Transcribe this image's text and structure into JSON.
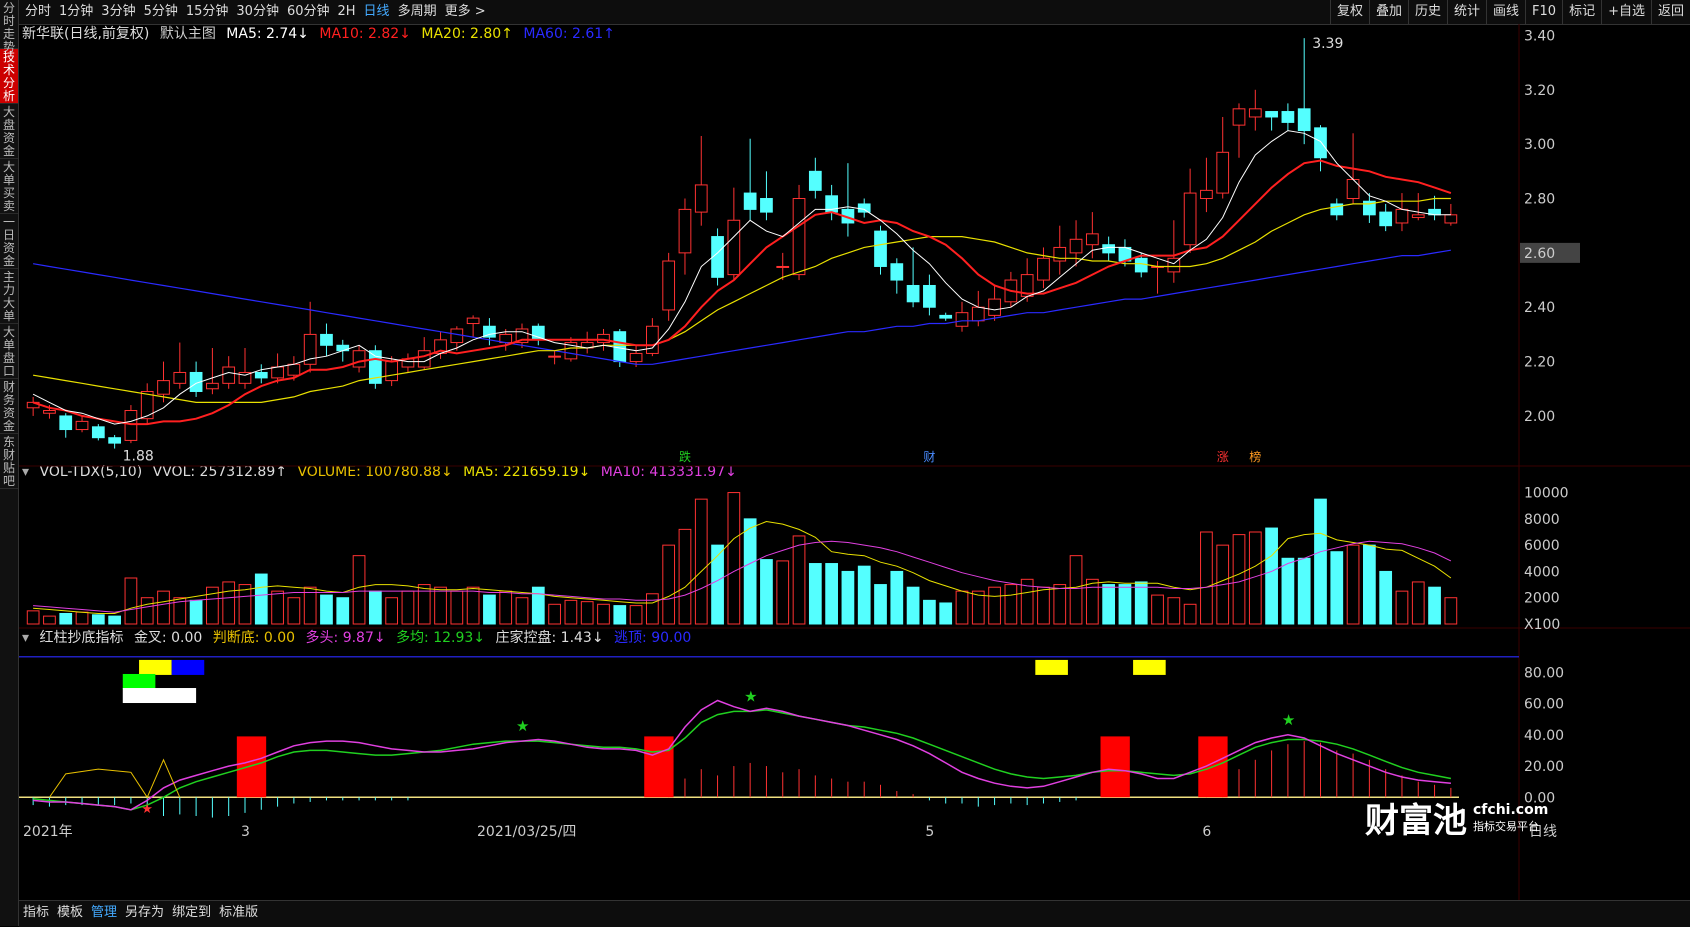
{
  "left_tabs": [
    "分时走势",
    "技术分析",
    "大盘资金",
    "大单买卖",
    "一日资金",
    "主力大单",
    "大单盘口",
    "财务资金",
    "东财贴吧"
  ],
  "active_left_tab": 1,
  "topbar": {
    "periods": [
      "分时",
      "1分钟",
      "3分钟",
      "5分钟",
      "15分钟",
      "30分钟",
      "60分钟",
      "2H",
      "日线",
      "多周期",
      "更多 >"
    ],
    "active_period": "日线",
    "right_buttons": [
      "复权",
      "叠加",
      "历史",
      "统计",
      "画线",
      "F10",
      "标记",
      "+自选",
      "返回"
    ]
  },
  "main_legend": {
    "stock": "新华联(日线,前复权)",
    "template": "默认主图",
    "ma5": "MA5: 2.74↓",
    "ma10": "MA10: 2.82↓",
    "ma20": "MA20: 2.80↑",
    "ma60": "MA60: 2.61↑"
  },
  "vol_legend": {
    "name": "VOL-TDX(5,10)",
    "vvol": "VVOL: 257312.89↑",
    "volume": "VOLUME: 100780.88↓",
    "ma5": "MA5: 221659.19↓",
    "ma10": "MA10: 413331.97↓"
  },
  "ind_legend": {
    "name": "红柱抄底指标",
    "jincha": "金叉: 0.00",
    "pandidi": "判断底: 0.00",
    "duotou": "多头: 9.87↓",
    "duojun": "多均: 12.93↓",
    "zhuangjia": "庄家控盘: 1.43↓",
    "taoding": "逃顶: 90.00"
  },
  "price_axis": [
    "3.40",
    "3.20",
    "3.00",
    "2.80",
    "2.60",
    "2.40",
    "2.20",
    "2.00"
  ],
  "current_price": "2.60",
  "vol_axis": [
    "10000",
    "8000",
    "6000",
    "4000",
    "2000",
    "X100"
  ],
  "ind_axis": [
    "80.00",
    "60.00",
    "40.00",
    "20.00",
    "0.00"
  ],
  "annotations": {
    "high": "3.39",
    "low": "1.88"
  },
  "event_markers": [
    "跌",
    "财",
    "涨",
    "榜"
  ],
  "time_axis": [
    "2021年",
    "3",
    "2021/03/25/四",
    "5",
    "6"
  ],
  "period_corner": "日线",
  "bottombar": {
    "items": [
      "指标",
      "模板",
      "管理",
      "另存为",
      "绑定到",
      "标准版"
    ],
    "active": "管理"
  },
  "watermark": {
    "brand": "财富池",
    "site": "cfchi.com",
    "tagline": "指标交易平台"
  },
  "colors": {
    "up": "#ff3232",
    "down": "#54ffff",
    "ma5": "#ffffff",
    "ma10": "#ff2020",
    "ma20": "#e8e000",
    "ma60": "#2a2aff",
    "magenta": "#e040e0",
    "green": "#20d020"
  },
  "chart_data": {
    "type": "candlestick",
    "price_range": [
      1.86,
      3.42
    ],
    "candles": [
      [
        2.03,
        2.05,
        2.0,
        2.07
      ],
      [
        2.01,
        2.02,
        1.99,
        2.04
      ],
      [
        2.0,
        1.95,
        1.92,
        2.01
      ],
      [
        1.95,
        1.98,
        1.94,
        2.0
      ],
      [
        1.96,
        1.92,
        1.91,
        1.97
      ],
      [
        1.92,
        1.9,
        1.88,
        1.93
      ],
      [
        1.91,
        2.02,
        1.9,
        2.04
      ],
      [
        1.99,
        2.09,
        1.97,
        2.12
      ],
      [
        2.08,
        2.13,
        2.05,
        2.2
      ],
      [
        2.12,
        2.16,
        2.1,
        2.27
      ],
      [
        2.16,
        2.09,
        2.07,
        2.2
      ],
      [
        2.1,
        2.12,
        2.08,
        2.25
      ],
      [
        2.12,
        2.18,
        2.1,
        2.22
      ],
      [
        2.12,
        2.16,
        2.1,
        2.25
      ],
      [
        2.16,
        2.14,
        2.12,
        2.19
      ],
      [
        2.14,
        2.18,
        2.12,
        2.23
      ],
      [
        2.15,
        2.19,
        2.13,
        2.22
      ],
      [
        2.19,
        2.3,
        2.16,
        2.42
      ],
      [
        2.3,
        2.26,
        2.22,
        2.34
      ],
      [
        2.26,
        2.24,
        2.2,
        2.28
      ],
      [
        2.18,
        2.24,
        2.16,
        2.26
      ],
      [
        2.24,
        2.12,
        2.1,
        2.26
      ],
      [
        2.13,
        2.2,
        2.11,
        2.22
      ],
      [
        2.18,
        2.21,
        2.16,
        2.23
      ],
      [
        2.18,
        2.24,
        2.17,
        2.29
      ],
      [
        2.23,
        2.28,
        2.21,
        2.31
      ],
      [
        2.27,
        2.32,
        2.24,
        2.33
      ],
      [
        2.34,
        2.36,
        2.29,
        2.37
      ],
      [
        2.33,
        2.29,
        2.26,
        2.36
      ],
      [
        2.27,
        2.3,
        2.24,
        2.32
      ],
      [
        2.27,
        2.32,
        2.25,
        2.34
      ],
      [
        2.33,
        2.28,
        2.26,
        2.34
      ],
      [
        2.22,
        2.22,
        2.19,
        2.24
      ],
      [
        2.21,
        2.27,
        2.2,
        2.29
      ],
      [
        2.25,
        2.27,
        2.23,
        2.31
      ],
      [
        2.27,
        2.3,
        2.24,
        2.32
      ],
      [
        2.31,
        2.2,
        2.18,
        2.32
      ],
      [
        2.2,
        2.23,
        2.18,
        2.26
      ],
      [
        2.23,
        2.33,
        2.22,
        2.36
      ],
      [
        2.39,
        2.57,
        2.35,
        2.6
      ],
      [
        2.6,
        2.76,
        2.52,
        2.8
      ],
      [
        2.75,
        2.85,
        2.7,
        3.03
      ],
      [
        2.66,
        2.51,
        2.48,
        2.69
      ],
      [
        2.52,
        2.72,
        2.5,
        2.84
      ],
      [
        2.82,
        2.76,
        2.72,
        3.02
      ],
      [
        2.8,
        2.75,
        2.72,
        2.9
      ],
      [
        2.55,
        2.55,
        2.5,
        2.6
      ],
      [
        2.52,
        2.8,
        2.5,
        2.85
      ],
      [
        2.9,
        2.83,
        2.8,
        2.95
      ],
      [
        2.81,
        2.75,
        2.72,
        2.85
      ],
      [
        2.76,
        2.71,
        2.66,
        2.93
      ],
      [
        2.78,
        2.75,
        2.73,
        2.8
      ],
      [
        2.68,
        2.55,
        2.52,
        2.7
      ],
      [
        2.56,
        2.5,
        2.45,
        2.58
      ],
      [
        2.48,
        2.42,
        2.4,
        2.62
      ],
      [
        2.48,
        2.4,
        2.37,
        2.52
      ],
      [
        2.37,
        2.36,
        2.35,
        2.38
      ],
      [
        2.33,
        2.38,
        2.31,
        2.42
      ],
      [
        2.35,
        2.4,
        2.33,
        2.46
      ],
      [
        2.37,
        2.43,
        2.35,
        2.48
      ],
      [
        2.42,
        2.5,
        2.4,
        2.53
      ],
      [
        2.44,
        2.52,
        2.42,
        2.58
      ],
      [
        2.5,
        2.58,
        2.47,
        2.62
      ],
      [
        2.57,
        2.62,
        2.52,
        2.7
      ],
      [
        2.6,
        2.65,
        2.55,
        2.72
      ],
      [
        2.63,
        2.67,
        2.58,
        2.75
      ],
      [
        2.63,
        2.6,
        2.57,
        2.66
      ],
      [
        2.62,
        2.57,
        2.55,
        2.65
      ],
      [
        2.58,
        2.53,
        2.51,
        2.6
      ],
      [
        2.55,
        2.55,
        2.45,
        2.57
      ],
      [
        2.53,
        2.58,
        2.49,
        2.72
      ],
      [
        2.63,
        2.82,
        2.6,
        2.91
      ],
      [
        2.8,
        2.83,
        2.75,
        2.95
      ],
      [
        2.82,
        2.97,
        2.8,
        3.1
      ],
      [
        3.07,
        3.13,
        2.95,
        3.15
      ],
      [
        3.1,
        3.13,
        3.05,
        3.2
      ],
      [
        3.12,
        3.1,
        3.05,
        3.12
      ],
      [
        3.12,
        3.08,
        3.05,
        3.15
      ],
      [
        3.13,
        3.05,
        3.0,
        3.39
      ],
      [
        3.06,
        2.95,
        2.9,
        3.07
      ],
      [
        2.78,
        2.74,
        2.72,
        2.8
      ],
      [
        2.8,
        2.87,
        2.78,
        3.04
      ],
      [
        2.79,
        2.74,
        2.71,
        2.82
      ],
      [
        2.75,
        2.7,
        2.68,
        2.78
      ],
      [
        2.71,
        2.76,
        2.68,
        2.82
      ],
      [
        2.73,
        2.74,
        2.72,
        2.82
      ],
      [
        2.76,
        2.74,
        2.72,
        2.81
      ],
      [
        2.71,
        2.74,
        2.7,
        2.78
      ]
    ],
    "ma5": [
      2.08,
      2.05,
      2.02,
      2.01,
      1.99,
      1.97,
      1.98,
      2.0,
      2.03,
      2.08,
      2.12,
      2.14,
      2.16,
      2.15,
      2.17,
      2.18,
      2.19,
      2.21,
      2.22,
      2.24,
      2.26,
      2.22,
      2.21,
      2.2,
      2.2,
      2.23,
      2.25,
      2.28,
      2.3,
      2.31,
      2.31,
      2.29,
      2.27,
      2.26,
      2.25,
      2.26,
      2.25,
      2.24,
      2.25,
      2.32,
      2.42,
      2.55,
      2.6,
      2.66,
      2.72,
      2.68,
      2.66,
      2.71,
      2.76,
      2.76,
      2.77,
      2.76,
      2.72,
      2.67,
      2.61,
      2.56,
      2.49,
      2.43,
      2.4,
      2.39,
      2.4,
      2.44,
      2.46,
      2.51,
      2.56,
      2.61,
      2.62,
      2.62,
      2.6,
      2.58,
      2.56,
      2.61,
      2.65,
      2.73,
      2.86,
      2.96,
      3.01,
      3.05,
      3.04,
      3.01,
      2.93,
      2.87,
      2.81,
      2.79,
      2.76,
      2.75,
      2.74,
      2.74
    ],
    "ma10": [
      2.05,
      2.03,
      2.02,
      2.0,
      1.99,
      1.98,
      1.97,
      1.97,
      1.98,
      1.98,
      1.99,
      2.01,
      2.04,
      2.08,
      2.11,
      2.13,
      2.14,
      2.17,
      2.17,
      2.18,
      2.2,
      2.21,
      2.2,
      2.21,
      2.22,
      2.24,
      2.23,
      2.24,
      2.25,
      2.26,
      2.28,
      2.28,
      2.28,
      2.28,
      2.28,
      2.28,
      2.27,
      2.26,
      2.26,
      2.28,
      2.33,
      2.4,
      2.46,
      2.5,
      2.56,
      2.62,
      2.66,
      2.7,
      2.74,
      2.75,
      2.73,
      2.71,
      2.72,
      2.71,
      2.68,
      2.66,
      2.63,
      2.58,
      2.52,
      2.48,
      2.46,
      2.45,
      2.45,
      2.47,
      2.49,
      2.52,
      2.55,
      2.57,
      2.59,
      2.59,
      2.59,
      2.61,
      2.62,
      2.66,
      2.72,
      2.78,
      2.84,
      2.89,
      2.93,
      2.94,
      2.92,
      2.91,
      2.9,
      2.88,
      2.87,
      2.86,
      2.84,
      2.82
    ],
    "ma20": [
      2.15,
      2.14,
      2.13,
      2.12,
      2.11,
      2.1,
      2.09,
      2.08,
      2.07,
      2.06,
      2.05,
      2.05,
      2.05,
      2.05,
      2.05,
      2.06,
      2.07,
      2.09,
      2.1,
      2.11,
      2.13,
      2.14,
      2.15,
      2.16,
      2.17,
      2.18,
      2.19,
      2.2,
      2.21,
      2.22,
      2.23,
      2.24,
      2.24,
      2.25,
      2.25,
      2.26,
      2.26,
      2.26,
      2.26,
      2.28,
      2.31,
      2.35,
      2.39,
      2.42,
      2.45,
      2.48,
      2.51,
      2.53,
      2.55,
      2.58,
      2.6,
      2.62,
      2.63,
      2.64,
      2.65,
      2.66,
      2.66,
      2.66,
      2.65,
      2.64,
      2.62,
      2.6,
      2.59,
      2.58,
      2.58,
      2.57,
      2.57,
      2.56,
      2.56,
      2.55,
      2.55,
      2.55,
      2.56,
      2.58,
      2.61,
      2.64,
      2.68,
      2.71,
      2.74,
      2.76,
      2.77,
      2.78,
      2.78,
      2.79,
      2.79,
      2.79,
      2.8,
      2.8
    ],
    "ma60": [
      2.56,
      2.55,
      2.54,
      2.53,
      2.52,
      2.51,
      2.5,
      2.49,
      2.48,
      2.47,
      2.46,
      2.45,
      2.44,
      2.43,
      2.42,
      2.41,
      2.4,
      2.39,
      2.38,
      2.37,
      2.36,
      2.35,
      2.34,
      2.33,
      2.32,
      2.31,
      2.3,
      2.29,
      2.28,
      2.27,
      2.26,
      2.25,
      2.24,
      2.23,
      2.22,
      2.21,
      2.2,
      2.19,
      2.19,
      2.2,
      2.21,
      2.22,
      2.23,
      2.24,
      2.25,
      2.26,
      2.27,
      2.28,
      2.29,
      2.3,
      2.31,
      2.31,
      2.32,
      2.33,
      2.33,
      2.34,
      2.34,
      2.35,
      2.35,
      2.36,
      2.37,
      2.38,
      2.38,
      2.39,
      2.4,
      2.41,
      2.42,
      2.43,
      2.43,
      2.44,
      2.45,
      2.46,
      2.47,
      2.48,
      2.49,
      2.5,
      2.51,
      2.52,
      2.53,
      2.54,
      2.55,
      2.56,
      2.57,
      2.58,
      2.59,
      2.59,
      2.6,
      2.61
    ],
    "volume": [
      1000,
      600,
      800,
      900,
      700,
      600,
      3500,
      2000,
      2500,
      2000,
      1800,
      2800,
      3200,
      3000,
      3800,
      2500,
      2000,
      2800,
      2200,
      2000,
      5200,
      2500,
      2000,
      2500,
      3000,
      2800,
      2500,
      2800,
      2200,
      2500,
      2000,
      2800,
      1500,
      1800,
      1700,
      1500,
      1400,
      1400,
      2300,
      6000,
      7200,
      9500,
      6000,
      10000,
      8000,
      4900,
      4800,
      6700,
      4600,
      4600,
      4000,
      4400,
      3000,
      4000,
      2800,
      1800,
      1600,
      2500,
      2500,
      2800,
      3000,
      3400,
      2800,
      3000,
      5200,
      3400,
      3000,
      3000,
      3200,
      2200,
      2000,
      1500,
      7000,
      6000,
      6800,
      7000,
      7300,
      5000,
      5000,
      9500,
      5500,
      6000,
      6000,
      4000,
      2500,
      3200,
      2800,
      2000
    ],
    "vol_ma5": [
      1200,
      1100,
      1000,
      900,
      800,
      800,
      1200,
      1500,
      1700,
      1900,
      2100,
      2300,
      2500,
      2600,
      2800,
      2900,
      2800,
      2700,
      2500,
      2400,
      2800,
      3000,
      3000,
      2900,
      2700,
      2600,
      2600,
      2700,
      2600,
      2500,
      2400,
      2300,
      2100,
      2000,
      1900,
      1800,
      1700,
      1600,
      1600,
      2100,
      2800,
      4000,
      5200,
      6500,
      7300,
      7800,
      7600,
      7200,
      6600,
      5500,
      5300,
      5200,
      4700,
      4400,
      3900,
      3300,
      2900,
      2500,
      2200,
      2100,
      2200,
      2400,
      2600,
      2700,
      2800,
      3100,
      3200,
      3100,
      3100,
      3100,
      2800,
      2600,
      2800,
      3300,
      3800,
      4400,
      5200,
      6500,
      6800,
      6900,
      6400,
      6200,
      6000,
      5700,
      5600,
      5000,
      4400,
      3500
    ],
    "vol_ma10": [
      1400,
      1300,
      1200,
      1100,
      1000,
      900,
      1100,
      1300,
      1500,
      1700,
      1800,
      1900,
      2000,
      2100,
      2200,
      2300,
      2400,
      2400,
      2400,
      2400,
      2500,
      2500,
      2500,
      2500,
      2500,
      2500,
      2500,
      2500,
      2400,
      2400,
      2300,
      2300,
      2200,
      2100,
      2000,
      1900,
      1900,
      1800,
      1800,
      1900,
      2200,
      2700,
      3300,
      4000,
      4600,
      5200,
      5600,
      6000,
      6200,
      6300,
      6200,
      6000,
      5800,
      5500,
      5100,
      4700,
      4300,
      3900,
      3600,
      3300,
      3100,
      2900,
      2800,
      2700,
      2700,
      2800,
      2800,
      2800,
      2800,
      2800,
      2700,
      2700,
      2800,
      3000,
      3200,
      3600,
      4000,
      4600,
      5000,
      5500,
      5800,
      6100,
      6300,
      6200,
      6100,
      5800,
      5400,
      4800
    ],
    "ind_magenta": [
      -2,
      -3,
      -3,
      -4,
      -5,
      -6,
      -8,
      -2,
      6,
      11,
      14,
      17,
      20,
      22,
      25,
      29,
      33,
      35,
      36,
      36,
      35,
      33,
      31,
      30,
      29,
      29,
      30,
      31,
      33,
      35,
      36,
      37,
      36,
      34,
      32,
      31,
      31,
      30,
      27,
      31,
      45,
      56,
      62,
      58,
      55,
      57,
      55,
      52,
      50,
      48,
      46,
      43,
      40,
      37,
      33,
      28,
      22,
      16,
      12,
      9,
      7,
      6,
      7,
      10,
      13,
      16,
      18,
      17,
      15,
      12,
      12,
      16,
      20,
      25,
      30,
      35,
      38,
      40,
      38,
      33,
      28,
      24,
      20,
      16,
      13,
      11,
      10,
      9
    ],
    "ind_green": [
      -1,
      -2,
      -3,
      -4,
      -5,
      -6,
      -8,
      -5,
      0,
      6,
      10,
      13,
      16,
      19,
      22,
      26,
      29,
      30,
      30,
      29,
      28,
      27,
      27,
      28,
      29,
      30,
      32,
      34,
      35,
      36,
      36,
      36,
      35,
      34,
      33,
      32,
      32,
      31,
      29,
      30,
      38,
      48,
      53,
      55,
      55,
      56,
      54,
      52,
      50,
      48,
      46,
      45,
      43,
      41,
      38,
      34,
      30,
      26,
      22,
      18,
      15,
      13,
      12,
      13,
      14,
      16,
      17,
      17,
      16,
      15,
      14,
      15,
      18,
      22,
      27,
      32,
      35,
      37,
      37,
      36,
      34,
      31,
      27,
      23,
      19,
      16,
      14,
      12
    ],
    "ind_bars": [
      -5,
      -6,
      -5,
      -5,
      -5,
      -5,
      -4,
      -8,
      -12,
      -11,
      -12,
      -13,
      -12,
      -10,
      -8,
      -6,
      -4,
      -3,
      -2,
      -2,
      -2,
      -2,
      -2,
      -2,
      0,
      0,
      0,
      0,
      0,
      0,
      0,
      0,
      0,
      0,
      0,
      0,
      0,
      0,
      0,
      6,
      12,
      18,
      14,
      20,
      22,
      20,
      16,
      18,
      14,
      12,
      10,
      10,
      8,
      4,
      2,
      -2,
      -4,
      -4,
      -6,
      -5,
      -4,
      -5,
      -4,
      -3,
      -2,
      0,
      0,
      0,
      0,
      0,
      0,
      0,
      8,
      12,
      18,
      24,
      30,
      34,
      36,
      35,
      30,
      28,
      24,
      18,
      14,
      10,
      8,
      6
    ],
    "red_blocks": [
      13,
      38,
      66,
      72
    ]
  }
}
